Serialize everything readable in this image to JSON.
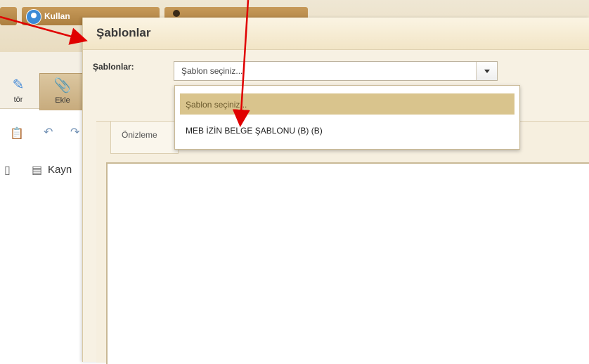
{
  "background": {
    "user_tab_label": "Kullan",
    "ribbon": {
      "editor_label": "tör",
      "ekle_label": "Ekle"
    },
    "toolbar_label": "Kayn"
  },
  "dialog": {
    "title": "Şablonlar",
    "field_label": "Şablonlar:",
    "select": {
      "value": "Şablon seçiniz..."
    },
    "tab_label": "Önizleme"
  },
  "dropdown": {
    "options": [
      {
        "label": "Şablon seçiniz...",
        "state": "selected"
      },
      {
        "label": "MEB İZİN BELGE ŞABLONU (B) (B)",
        "state": "normal"
      }
    ]
  },
  "colors": {
    "accent": "#d9c48d",
    "annotation_arrow": "#e00000",
    "header_bg": "#f2e5c6"
  }
}
